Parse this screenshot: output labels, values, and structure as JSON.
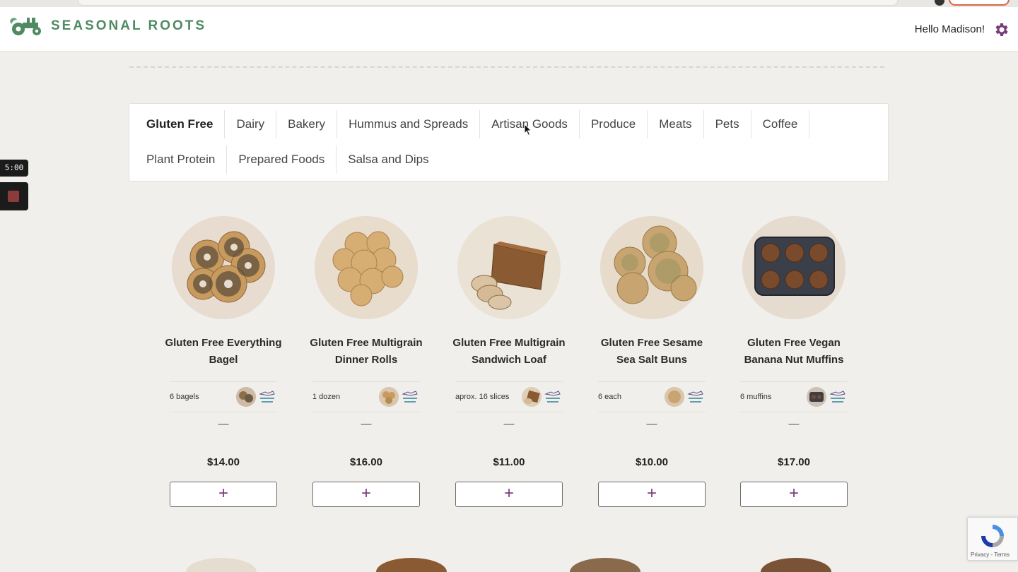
{
  "brand": {
    "name": "SEASONAL ROOTS",
    "color": "#4f8a63"
  },
  "header": {
    "greeting": "Hello Madison!",
    "settings_icon": "gear-icon"
  },
  "recorder": {
    "timer": "5:00",
    "stop_icon": "stop-icon"
  },
  "categories": {
    "row1": [
      "Gluten Free",
      "Dairy",
      "Bakery",
      "Hummus and Spreads",
      "Artisan Goods",
      "Produce",
      "Meats",
      "Pets",
      "Coffee"
    ],
    "row2": [
      "Plant Protein",
      "Prepared Foods",
      "Salsa and Dips"
    ],
    "active": "Gluten Free"
  },
  "products": [
    {
      "name": "Gluten Free Everything Bagel",
      "quantity": "6 bagels",
      "price": "$14.00",
      "dash": "—",
      "add_label": "+"
    },
    {
      "name": "Gluten Free Multigrain Dinner Rolls",
      "quantity": "1 dozen",
      "price": "$16.00",
      "dash": "—",
      "add_label": "+"
    },
    {
      "name": "Gluten Free Multigrain Sandwich Loaf",
      "quantity": "aprox. 16 slices",
      "price": "$11.00",
      "dash": "—",
      "add_label": "+"
    },
    {
      "name": "Gluten Free Sesame Sea Salt Buns",
      "quantity": "6 each",
      "price": "$10.00",
      "dash": "—",
      "add_label": "+"
    },
    {
      "name": "Gluten Free Vegan Banana Nut Muffins",
      "quantity": "6 muffins",
      "price": "$17.00",
      "dash": "—",
      "add_label": "+"
    }
  ],
  "badge": {
    "text": "GLUTEN FREE"
  },
  "recaptcha": {
    "terms": "Privacy - Terms"
  },
  "colors": {
    "accent_purple": "#7b3c7d",
    "background": "#f1efeb"
  }
}
